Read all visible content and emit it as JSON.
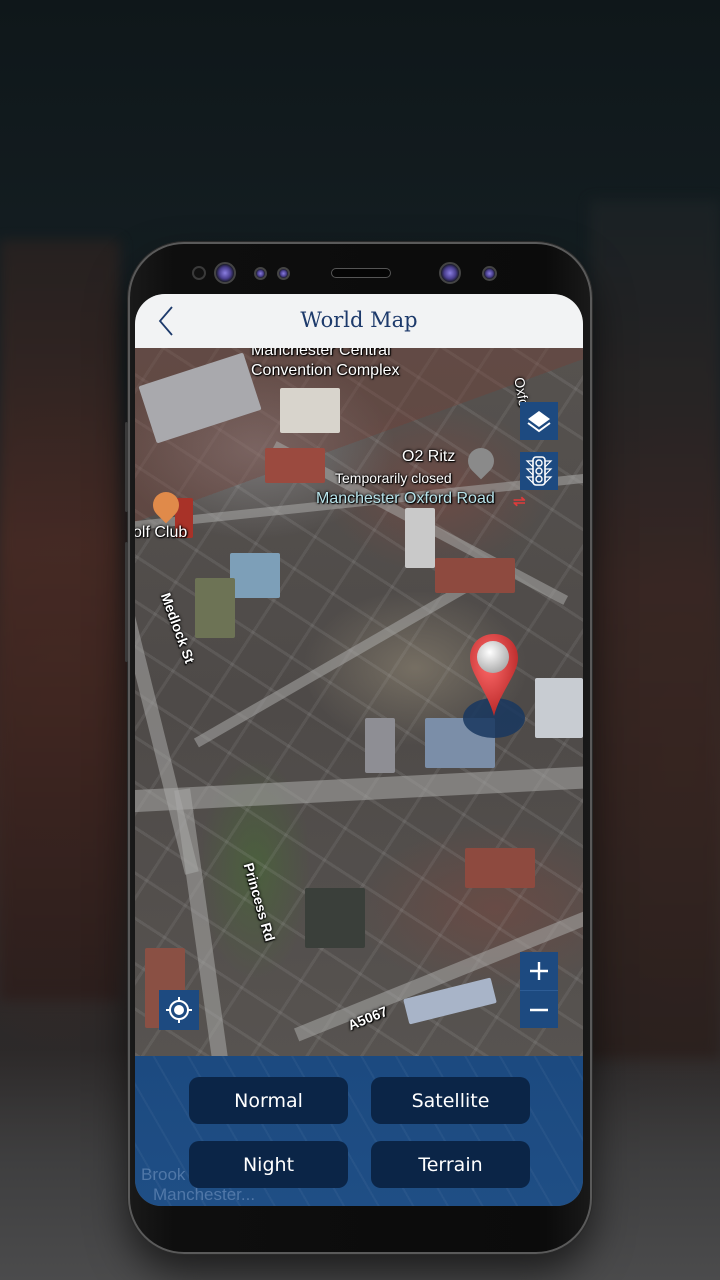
{
  "header": {
    "title": "World Map",
    "back_icon": "chevron-left-icon"
  },
  "map": {
    "labels": {
      "convention_line1": "Manchester Central",
      "convention_line2": "Convention Complex",
      "o2_ritz": "O2 Ritz",
      "o2_status": "Temporarily closed",
      "station": "Manchester Oxford Road",
      "golf_club": "olf Club",
      "medlock": "Medlock St",
      "princess": "Princess Rd",
      "a5067": "A5067",
      "oxford_edge": "Oxfo"
    },
    "controls": {
      "layers_icon": "layers-icon",
      "traffic_icon": "traffic-light-icon",
      "locate_icon": "my-location-icon",
      "zoom_in": "+",
      "zoom_out": "−"
    },
    "pin_icon": "map-pin-icon"
  },
  "map_types": {
    "normal": "Normal",
    "satellite": "Satellite",
    "night": "Night",
    "terrain": "Terrain"
  },
  "bottom_ghost": {
    "line1": "Brook",
    "line2": "Manchester..."
  },
  "colors": {
    "accent": "#1d4a80",
    "title": "#1d3a6b",
    "button_bg": "#0b2547",
    "pin": "#d03a3a"
  }
}
